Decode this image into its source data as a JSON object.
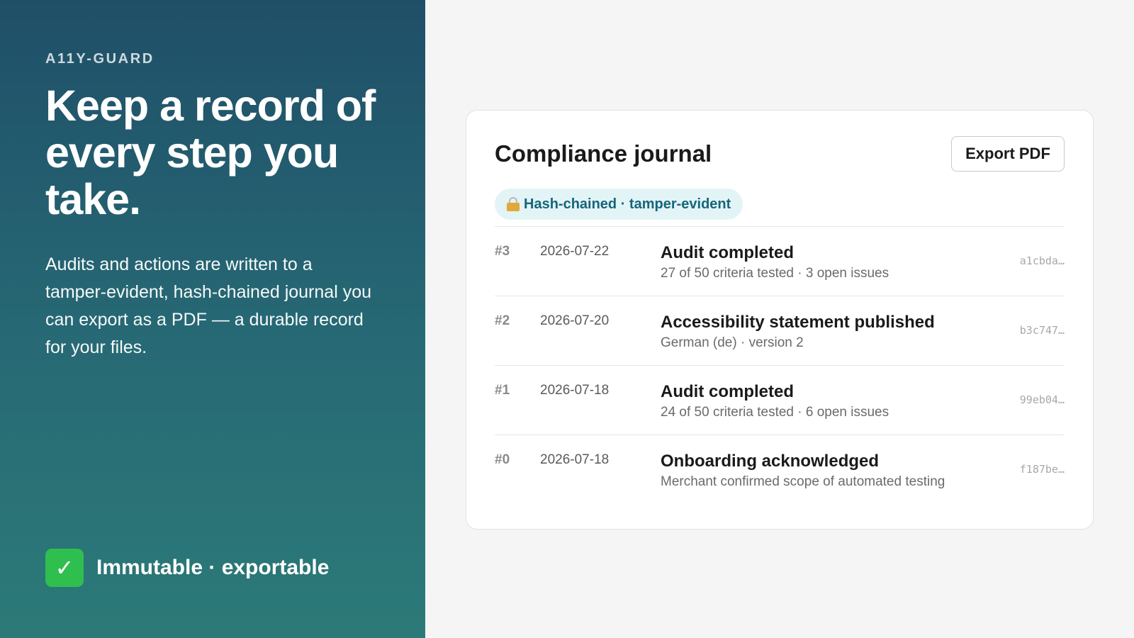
{
  "hero": {
    "brand": "A11Y-GUARD",
    "headline": "Keep a record of every step you take.",
    "description": "Audits and actions are written to a tamper-evident, hash-chained journal you can export as a PDF — a durable record for your files.",
    "footer_icon": "✓",
    "footer_text": "Immutable · exportable"
  },
  "journal": {
    "title": "Compliance journal",
    "export_label": "Export PDF",
    "badge": "Hash-chained · tamper-evident",
    "entries": [
      {
        "num": "#3",
        "date": "2026-07-22",
        "title": "Audit completed",
        "subtitle": "27 of 50 criteria tested · 3 open issues",
        "hash": "a1cbda…"
      },
      {
        "num": "#2",
        "date": "2026-07-20",
        "title": "Accessibility statement published",
        "subtitle": "German (de) · version 2",
        "hash": "b3c747…"
      },
      {
        "num": "#1",
        "date": "2026-07-18",
        "title": "Audit completed",
        "subtitle": "24 of 50 criteria tested · 6 open issues",
        "hash": "99eb04…"
      },
      {
        "num": "#0",
        "date": "2026-07-18",
        "title": "Onboarding acknowledged",
        "subtitle": "Merchant confirmed scope of automated testing",
        "hash": "f187be…"
      }
    ]
  },
  "colors": {
    "accent_teal": "#17657a",
    "check_green": "#2fbf4f",
    "panel_gradient_top": "#1f4f68",
    "panel_gradient_bottom": "#2c7a78"
  },
  "icons": {
    "badge_icon": "lock-icon",
    "footer_icon": "check-icon"
  }
}
